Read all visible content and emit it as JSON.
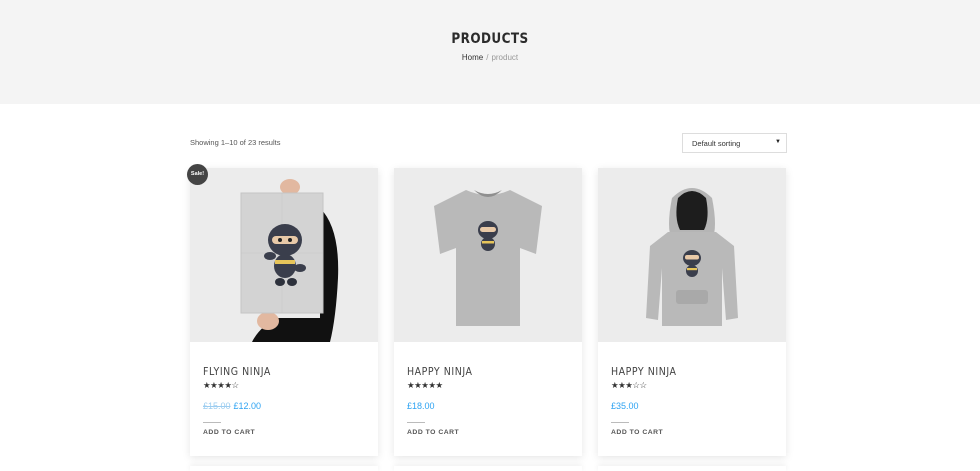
{
  "header": {
    "title": "PRODUCTS",
    "breadcrumb": {
      "home": "Home",
      "separator": "/",
      "current": "product"
    }
  },
  "toolbar": {
    "result_count": "Showing 1–10 of 23 results",
    "sorting": {
      "selected": "Default sorting",
      "icon": "chevron-down-icon"
    }
  },
  "products": [
    {
      "name": "FLYING NINJA",
      "rating": 4,
      "stars": "★★★★☆",
      "old_price": "£15.00",
      "price": "£12.00",
      "sale_badge": "Sale!",
      "cta": "ADD TO CART",
      "image_icon": "ninja-poster-image"
    },
    {
      "name": "HAPPY NINJA",
      "rating": 5,
      "stars": "★★★★★",
      "price": "£18.00",
      "cta": "ADD TO CART",
      "image_icon": "ninja-tshirt-image"
    },
    {
      "name": "HAPPY NINJA",
      "rating": 3,
      "stars": "★★★☆☆",
      "price": "£35.00",
      "cta": "ADD TO CART",
      "image_icon": "ninja-hoodie-image"
    }
  ],
  "colors": {
    "accent": "#2ea3f2",
    "hero_bg": "#f4f4f4",
    "image_bg": "#ebebeb",
    "badge_bg": "#444444"
  }
}
